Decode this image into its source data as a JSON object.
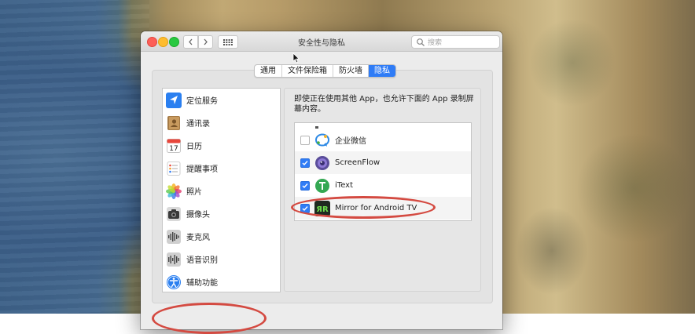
{
  "window": {
    "title": "安全性与隐私",
    "search_placeholder": "搜索"
  },
  "tabs": [
    {
      "label": "通用",
      "active": false
    },
    {
      "label": "文件保险箱",
      "active": false
    },
    {
      "label": "防火墙",
      "active": false
    },
    {
      "label": "隐私",
      "active": true
    }
  ],
  "sidebar": {
    "items": [
      {
        "label": "定位服务",
        "icon": "location-arrow-icon"
      },
      {
        "label": "通讯录",
        "icon": "contacts-book-icon"
      },
      {
        "label": "日历",
        "icon": "calendar-icon",
        "icon_text": "17"
      },
      {
        "label": "提醒事项",
        "icon": "reminders-icon"
      },
      {
        "label": "照片",
        "icon": "photos-icon"
      },
      {
        "label": "摄像头",
        "icon": "camera-icon"
      },
      {
        "label": "麦克风",
        "icon": "microphone-icon"
      },
      {
        "label": "语音识别",
        "icon": "speech-recognition-icon"
      },
      {
        "label": "辅助功能",
        "icon": "accessibility-icon"
      }
    ]
  },
  "main": {
    "description": "即使正在使用其他 App，也允许下面的 App 录制屏幕内容。",
    "apps": [
      {
        "label": "企业微信",
        "checked": false,
        "icon": "wecom-icon"
      },
      {
        "label": "ScreenFlow",
        "checked": true,
        "icon": "screenflow-icon"
      },
      {
        "label": "iText",
        "checked": true,
        "icon": "itext-icon"
      },
      {
        "label": "Mirror for Android TV",
        "checked": true,
        "icon": "mirror-android-tv-icon",
        "icon_text": "ЯR"
      }
    ]
  },
  "colors": {
    "accent": "#2f7cf6",
    "annotation": "#d44a41"
  }
}
